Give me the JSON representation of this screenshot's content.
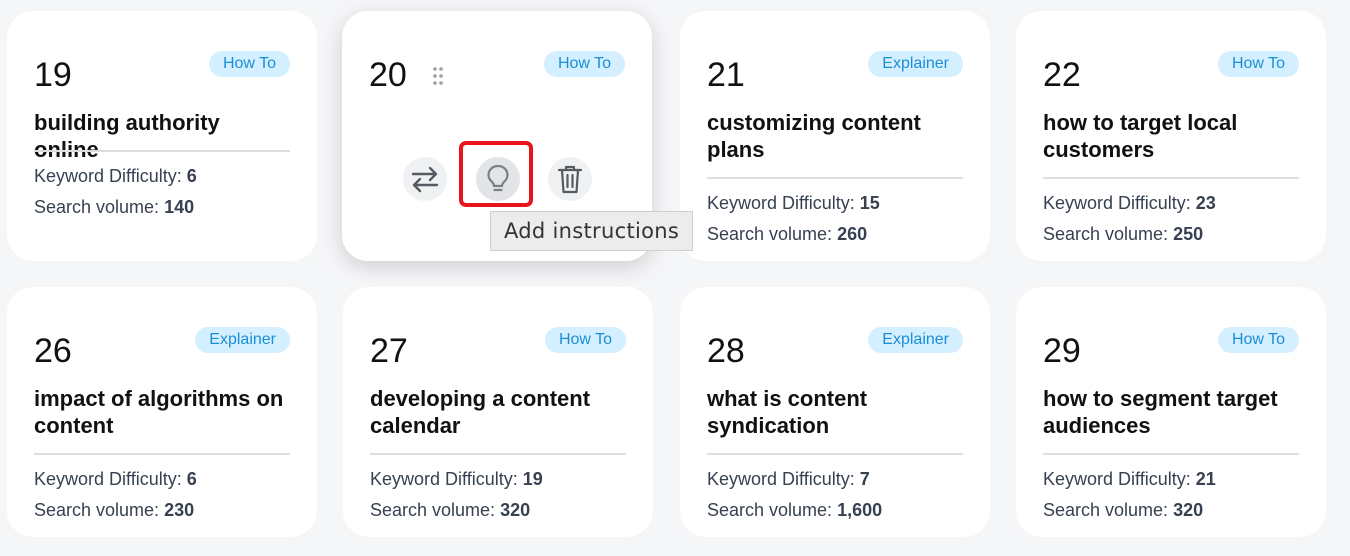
{
  "cards": [
    {
      "number": "19",
      "tag": "How To",
      "title": "building authority online",
      "kd_label": "Keyword Difficulty:",
      "kd": "6",
      "sv_label": "Search volume:",
      "sv": "140"
    },
    {
      "number": "20",
      "tag": "How To",
      "title": "",
      "kd_label": "",
      "kd": "",
      "sv_label": "",
      "sv": ""
    },
    {
      "number": "21",
      "tag": "Explainer",
      "title": "customizing content plans",
      "kd_label": "Keyword Difficulty:",
      "kd": "15",
      "sv_label": "Search volume:",
      "sv": "260"
    },
    {
      "number": "22",
      "tag": "How To",
      "title": "how to target local customers",
      "kd_label": "Keyword Difficulty:",
      "kd": "23",
      "sv_label": "Search volume:",
      "sv": "250"
    },
    {
      "number": "26",
      "tag": "Explainer",
      "title": "impact of algorithms on content",
      "kd_label": "Keyword Difficulty:",
      "kd": "6",
      "sv_label": "Search volume:",
      "sv": "230"
    },
    {
      "number": "27",
      "tag": "How To",
      "title": "developing a content calendar",
      "kd_label": "Keyword Difficulty:",
      "kd": "19",
      "sv_label": "Search volume:",
      "sv": "320"
    },
    {
      "number": "28",
      "tag": "Explainer",
      "title": "what is content syndication",
      "kd_label": "Keyword Difficulty:",
      "kd": "7",
      "sv_label": "Search volume:",
      "sv": "1,600"
    },
    {
      "number": "29",
      "tag": "How To",
      "title": "how to segment target audiences",
      "kd_label": "Keyword Difficulty:",
      "kd": "21",
      "sv_label": "Search volume:",
      "sv": "320"
    }
  ],
  "hover_actions": {
    "swap_icon": "swap-arrows-icon",
    "idea_icon": "lightbulb-icon",
    "delete_icon": "trash-icon",
    "drag_icon": "drag-handle-icon"
  },
  "tooltip": {
    "text": "Add instructions"
  },
  "colors": {
    "background": "#f5f6f8",
    "card": "#ffffff",
    "tag_bg": "#d4efff",
    "tag_text": "#1b8fd6",
    "highlight": "#e8141b"
  }
}
